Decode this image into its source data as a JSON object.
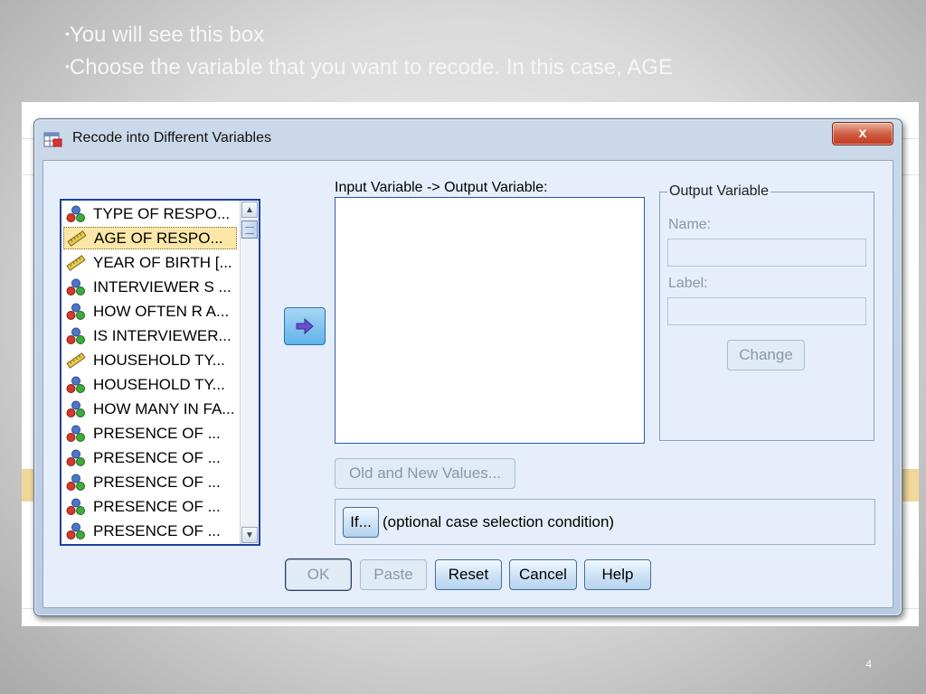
{
  "slide": {
    "bullets": [
      "You will see this box",
      "Choose the variable that you want to recode. In this case, AGE"
    ],
    "bullet_char": "•",
    "page_number": "4"
  },
  "dialog": {
    "title": "Recode into Different Variables",
    "close_symbol": "x",
    "variables": [
      {
        "label": "TYPE OF RESPO...",
        "icon": "nominal-icon",
        "selected": false
      },
      {
        "label": "AGE OF RESPO...",
        "icon": "scale-icon",
        "selected": true
      },
      {
        "label": "YEAR OF BIRTH [...",
        "icon": "scale-icon",
        "selected": false
      },
      {
        "label": "INTERVIEWER S ...",
        "icon": "nominal-icon",
        "selected": false
      },
      {
        "label": "HOW OFTEN R A...",
        "icon": "nominal-icon",
        "selected": false
      },
      {
        "label": "IS INTERVIEWER...",
        "icon": "nominal-icon",
        "selected": false
      },
      {
        "label": "HOUSEHOLD TY...",
        "icon": "scale-icon",
        "selected": false
      },
      {
        "label": "HOUSEHOLD TY...",
        "icon": "nominal-icon",
        "selected": false
      },
      {
        "label": "HOW MANY IN FA...",
        "icon": "nominal-icon",
        "selected": false
      },
      {
        "label": "PRESENCE OF ...",
        "icon": "nominal-icon",
        "selected": false
      },
      {
        "label": "PRESENCE OF ...",
        "icon": "nominal-icon",
        "selected": false
      },
      {
        "label": "PRESENCE OF ...",
        "icon": "nominal-icon",
        "selected": false
      },
      {
        "label": "PRESENCE OF ...",
        "icon": "nominal-icon",
        "selected": false
      },
      {
        "label": "PRESENCE OF ...",
        "icon": "nominal-icon",
        "selected": false
      }
    ],
    "io_label": "Input Variable -> Output Variable:",
    "output_group": {
      "legend": "Output Variable",
      "name_label": "Name:",
      "name_value": "",
      "label_label": "Label:",
      "label_value": "",
      "change_button": "Change"
    },
    "old_new_button": "Old and New Values...",
    "if_button": "If...",
    "condition_label": "(optional case selection condition)",
    "buttons": {
      "ok": "OK",
      "paste": "Paste",
      "reset": "Reset",
      "cancel": "Cancel",
      "help": "Help"
    }
  },
  "colors": {
    "selection": "#fbe7a8",
    "list_border": "#2040a0",
    "close_button": "#c13a21",
    "move_button": "#5fb3e9"
  }
}
